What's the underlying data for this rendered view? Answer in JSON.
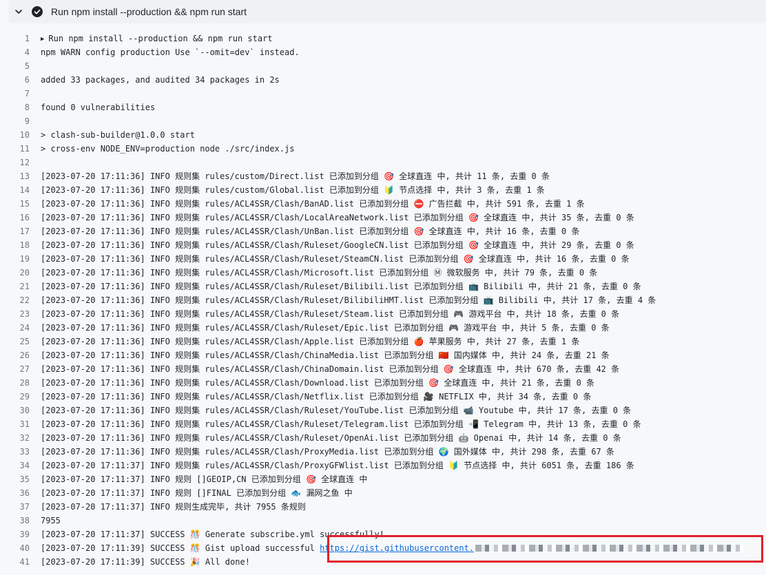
{
  "step": {
    "title": "Run npm install --production && npm run start",
    "status_icon": "check-circle-icon",
    "toggle_icon": "chevron-down-icon"
  },
  "colors": {
    "line_number": "#6e7781",
    "link": "#0969da",
    "highlight_box": "#e0202b"
  },
  "log_lines": [
    {
      "n": "1",
      "text": "Run npm install --production && npm run start",
      "group": true
    },
    {
      "n": "4",
      "text": "npm WARN config production Use `--omit=dev` instead."
    },
    {
      "n": "5",
      "text": ""
    },
    {
      "n": "6",
      "text": "added 33 packages, and audited 34 packages in 2s"
    },
    {
      "n": "7",
      "text": ""
    },
    {
      "n": "8",
      "text": "found 0 vulnerabilities"
    },
    {
      "n": "9",
      "text": ""
    },
    {
      "n": "10",
      "text": "> clash-sub-builder@1.0.0 start"
    },
    {
      "n": "11",
      "text": "> cross-env NODE_ENV=production node ./src/index.js"
    },
    {
      "n": "12",
      "text": ""
    },
    {
      "n": "13",
      "text": "[2023-07-20 17:11:36] INFO 规则集 rules/custom/Direct.list 已添加到分组 🎯 全球直连 中, 共计 11 条, 去重 0 条"
    },
    {
      "n": "14",
      "text": "[2023-07-20 17:11:36] INFO 规则集 rules/custom/Global.list 已添加到分组 🔰 节点选择 中, 共计 3 条, 去重 1 条"
    },
    {
      "n": "15",
      "text": "[2023-07-20 17:11:36] INFO 规则集 rules/ACL4SSR/Clash/BanAD.list 已添加到分组 ⛔ 广告拦截 中, 共计 591 条, 去重 1 条"
    },
    {
      "n": "16",
      "text": "[2023-07-20 17:11:36] INFO 规则集 rules/ACL4SSR/Clash/LocalAreaNetwork.list 已添加到分组 🎯 全球直连 中, 共计 35 条, 去重 0 条"
    },
    {
      "n": "17",
      "text": "[2023-07-20 17:11:36] INFO 规则集 rules/ACL4SSR/Clash/UnBan.list 已添加到分组 🎯 全球直连 中, 共计 16 条, 去重 0 条"
    },
    {
      "n": "18",
      "text": "[2023-07-20 17:11:36] INFO 规则集 rules/ACL4SSR/Clash/Ruleset/GoogleCN.list 已添加到分组 🎯 全球直连 中, 共计 29 条, 去重 0 条"
    },
    {
      "n": "19",
      "text": "[2023-07-20 17:11:36] INFO 规则集 rules/ACL4SSR/Clash/Ruleset/SteamCN.list 已添加到分组 🎯 全球直连 中, 共计 16 条, 去重 0 条"
    },
    {
      "n": "20",
      "text": "[2023-07-20 17:11:36] INFO 规则集 rules/ACL4SSR/Clash/Microsoft.list 已添加到分组 Ⓜ 微软服务 中, 共计 79 条, 去重 0 条"
    },
    {
      "n": "21",
      "text": "[2023-07-20 17:11:36] INFO 规则集 rules/ACL4SSR/Clash/Ruleset/Bilibili.list 已添加到分组 📺 Bilibili 中, 共计 21 条, 去重 0 条"
    },
    {
      "n": "22",
      "text": "[2023-07-20 17:11:36] INFO 规则集 rules/ACL4SSR/Clash/Ruleset/BilibiliHMT.list 已添加到分组 📺 Bilibili 中, 共计 17 条, 去重 4 条"
    },
    {
      "n": "23",
      "text": "[2023-07-20 17:11:36] INFO 规则集 rules/ACL4SSR/Clash/Ruleset/Steam.list 已添加到分组 🎮 游戏平台 中, 共计 18 条, 去重 0 条"
    },
    {
      "n": "24",
      "text": "[2023-07-20 17:11:36] INFO 规则集 rules/ACL4SSR/Clash/Ruleset/Epic.list 已添加到分组 🎮 游戏平台 中, 共计 5 条, 去重 0 条"
    },
    {
      "n": "25",
      "text": "[2023-07-20 17:11:36] INFO 规则集 rules/ACL4SSR/Clash/Apple.list 已添加到分组 🍎 苹果服务 中, 共计 27 条, 去重 1 条"
    },
    {
      "n": "26",
      "text": "[2023-07-20 17:11:36] INFO 规则集 rules/ACL4SSR/Clash/ChinaMedia.list 已添加到分组 🇨🇳 国内媒体 中, 共计 24 条, 去重 21 条"
    },
    {
      "n": "27",
      "text": "[2023-07-20 17:11:36] INFO 规则集 rules/ACL4SSR/Clash/ChinaDomain.list 已添加到分组 🎯 全球直连 中, 共计 670 条, 去重 42 条"
    },
    {
      "n": "28",
      "text": "[2023-07-20 17:11:36] INFO 规则集 rules/ACL4SSR/Clash/Download.list 已添加到分组 🎯 全球直连 中, 共计 21 条, 去重 0 条"
    },
    {
      "n": "29",
      "text": "[2023-07-20 17:11:36] INFO 规则集 rules/ACL4SSR/Clash/Netflix.list 已添加到分组 🎥 NETFLIX 中, 共计 34 条, 去重 0 条"
    },
    {
      "n": "30",
      "text": "[2023-07-20 17:11:36] INFO 规则集 rules/ACL4SSR/Clash/Ruleset/YouTube.list 已添加到分组 📹 Youtube 中, 共计 17 条, 去重 0 条"
    },
    {
      "n": "31",
      "text": "[2023-07-20 17:11:36] INFO 规则集 rules/ACL4SSR/Clash/Ruleset/Telegram.list 已添加到分组 📲 Telegram 中, 共计 13 条, 去重 0 条"
    },
    {
      "n": "32",
      "text": "[2023-07-20 17:11:36] INFO 规则集 rules/ACL4SSR/Clash/Ruleset/OpenAi.list 已添加到分组 🤖 Openai 中, 共计 14 条, 去重 0 条"
    },
    {
      "n": "33",
      "text": "[2023-07-20 17:11:36] INFO 规则集 rules/ACL4SSR/Clash/ProxyMedia.list 已添加到分组 🌍 国外媒体 中, 共计 298 条, 去重 67 条"
    },
    {
      "n": "34",
      "text": "[2023-07-20 17:11:37] INFO 规则集 rules/ACL4SSR/Clash/ProxyGFWlist.list 已添加到分组 🔰 节点选择 中, 共计 6051 条, 去重 186 条"
    },
    {
      "n": "35",
      "text": "[2023-07-20 17:11:37] INFO 规则 []GEOIP,CN 已添加到分组 🎯 全球直连 中"
    },
    {
      "n": "36",
      "text": "[2023-07-20 17:11:37] INFO 规则 []FINAL 已添加到分组 🐟 漏网之鱼 中"
    },
    {
      "n": "37",
      "text": "[2023-07-20 17:11:37] INFO 规则生成完毕, 共计 7955 条规则"
    },
    {
      "n": "38",
      "text": "7955"
    },
    {
      "n": "39",
      "text": "[2023-07-20 17:11:37] SUCCESS 🎊 Generate subscribe.yml successfully!"
    },
    {
      "n": "40",
      "text": "[2023-07-20 17:11:39] SUCCESS 🎊 Gist upload successful ",
      "link": "https://gist.githubusercontent.",
      "redacted": true
    },
    {
      "n": "41",
      "text": "[2023-07-20 17:11:39] SUCCESS 🎉 All done!"
    }
  ]
}
